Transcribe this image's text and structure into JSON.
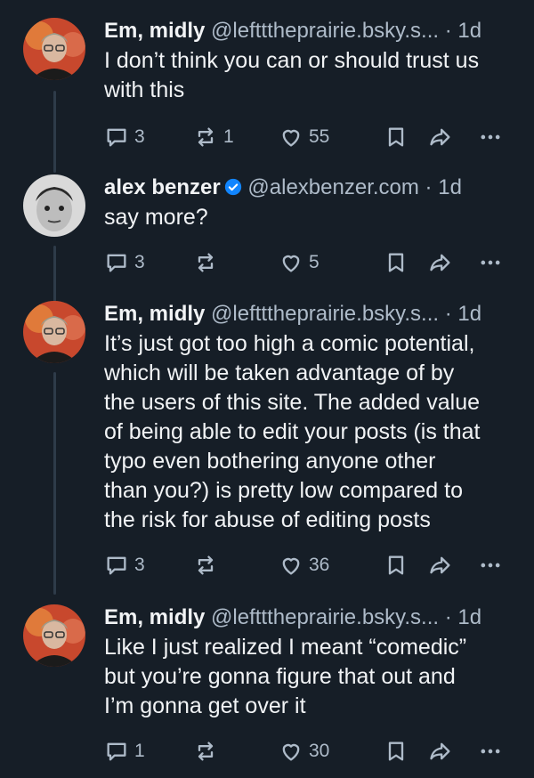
{
  "posts": [
    {
      "author": "Em, midly",
      "handle": "@leftttheprairie.bsky.s...",
      "verified": false,
      "separator": "·",
      "time": "1d",
      "text": "I don’t think you can or should trust us\nwith this",
      "replies": "3",
      "reposts": "1",
      "likes": "55",
      "avatar": "em-avatar"
    },
    {
      "author": "alex benzer",
      "handle": "@alexbenzer.com",
      "verified": true,
      "separator": "·",
      "time": "1d",
      "text": "say more?",
      "replies": "3",
      "reposts": "",
      "likes": "5",
      "avatar": "alex-avatar"
    },
    {
      "author": "Em, midly",
      "handle": "@leftttheprairie.bsky.s...",
      "verified": false,
      "separator": "·",
      "time": "1d",
      "text": "It’s just got too high a comic potential,\nwhich will be taken advantage of by\nthe users of this site. The added value\nof being able to edit your posts (is that\ntypo even bothering anyone other\nthan you?) is pretty low compared to\nthe risk for abuse of editing posts",
      "replies": "3",
      "reposts": "",
      "likes": "36",
      "avatar": "em-avatar"
    },
    {
      "author": "Em, midly",
      "handle": "@leftttheprairie.bsky.s...",
      "verified": false,
      "separator": "·",
      "time": "1d",
      "text": "Like I just realized I meant “comedic”\nbut you’re gonna figure that out and\nI’m gonna get over it",
      "replies": "1",
      "reposts": "",
      "likes": "30",
      "avatar": "em-avatar"
    }
  ],
  "colors": {
    "background": "#161e27",
    "text": "#f1f3f5",
    "muted": "#aebbc9",
    "verified": "#1185fe",
    "thread_line": "#2e3b49"
  }
}
